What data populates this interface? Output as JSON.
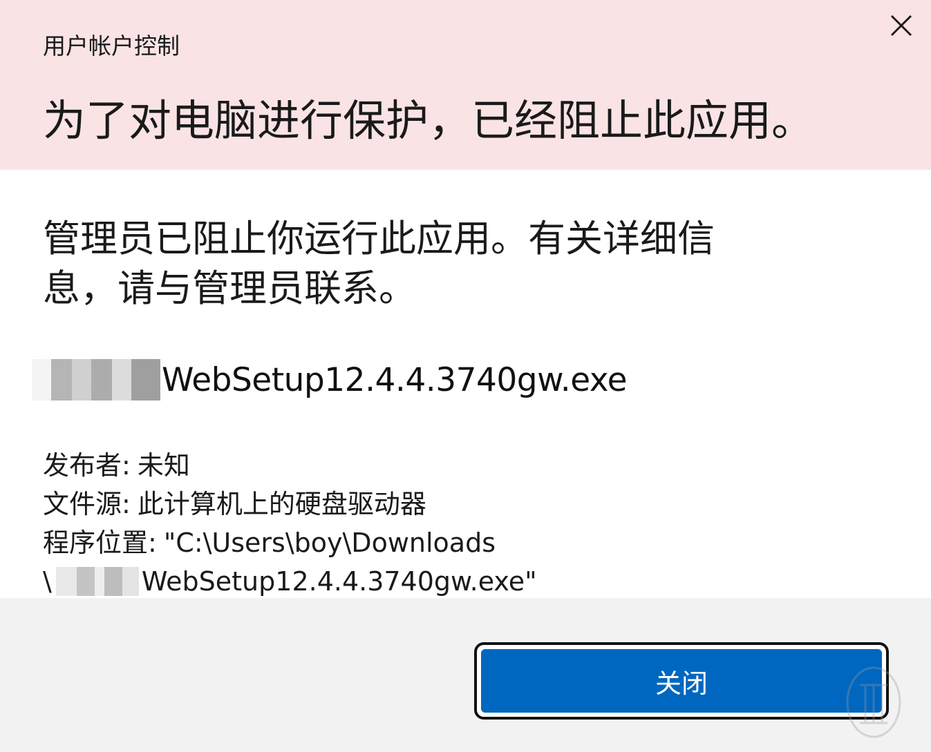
{
  "window": {
    "title": "用户帐户控制",
    "close_icon": "close-icon"
  },
  "header": {
    "headline": "为了对电脑进行保护，已经阻止此应用。"
  },
  "body": {
    "message": "管理员已阻止你运行此应用。有关详细信息，请与管理员联系。",
    "filename": "WebSetup12.4.4.3740gw.exe"
  },
  "details": {
    "publisher_label": "发布者:",
    "publisher_value": "未知",
    "source_label": "文件源:",
    "source_value": "此计算机上的硬盘驱动器",
    "location_label": "程序位置:",
    "location_line1": "\"C:\\Users\\boy\\Downloads",
    "location_line2_prefix": "\\",
    "location_line2_suffix": "WebSetup12.4.4.3740gw.exe\""
  },
  "footer": {
    "close_button_label": "关闭"
  },
  "colors": {
    "header_bg": "#f9e3e5",
    "footer_bg": "#f2f2f2",
    "accent": "#0067c0"
  }
}
